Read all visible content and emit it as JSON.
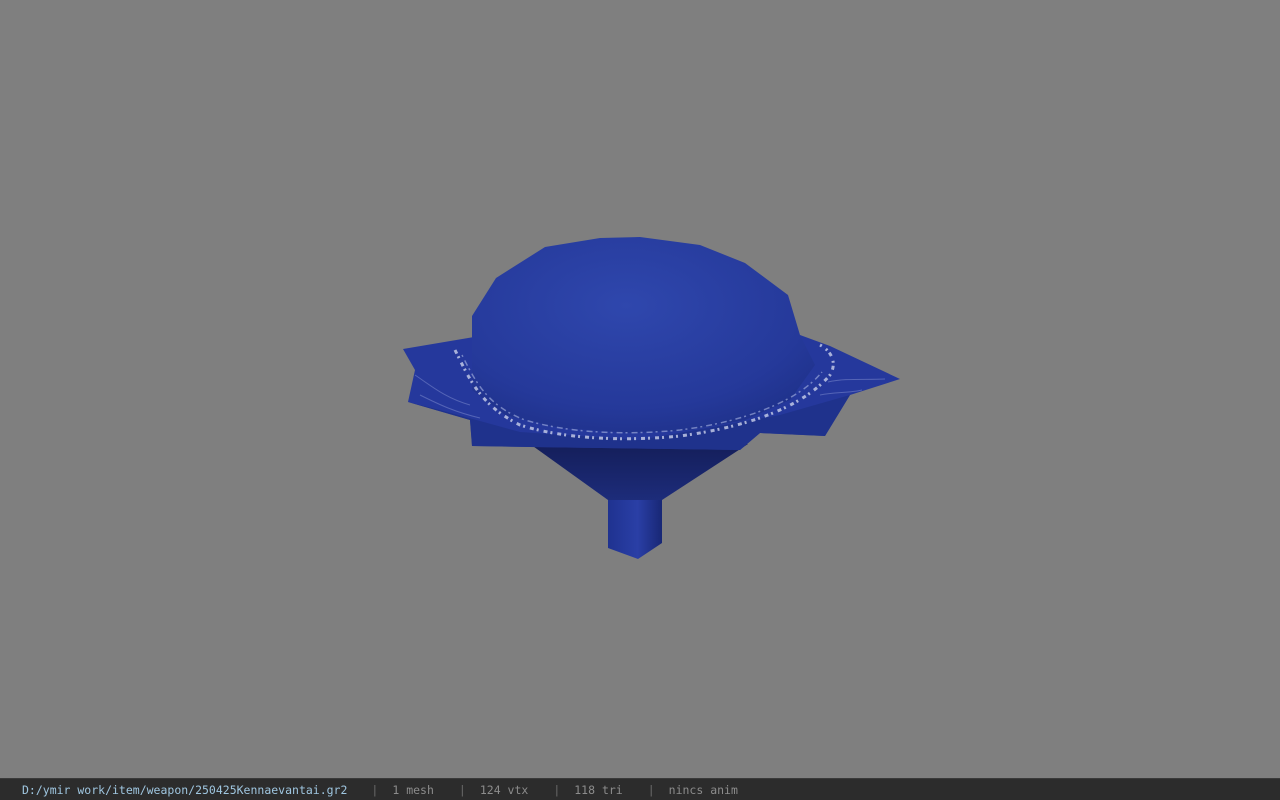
{
  "viewport": {
    "background_color": "#7f7f7f",
    "model": {
      "name": "blue-hat-mesh",
      "primary_color": "#2a3fa0",
      "shadow_color": "#1b2a6e",
      "trim_color": "#c9d0ea"
    }
  },
  "statusbar": {
    "file_path": "D:/ymir work/item/weapon/250425Kennaevantai.gr2",
    "separator": "|",
    "mesh_count": "1 mesh",
    "vertex_count": "124 vtx",
    "triangle_count": "118 tri",
    "anim_status": "nincs anim"
  }
}
